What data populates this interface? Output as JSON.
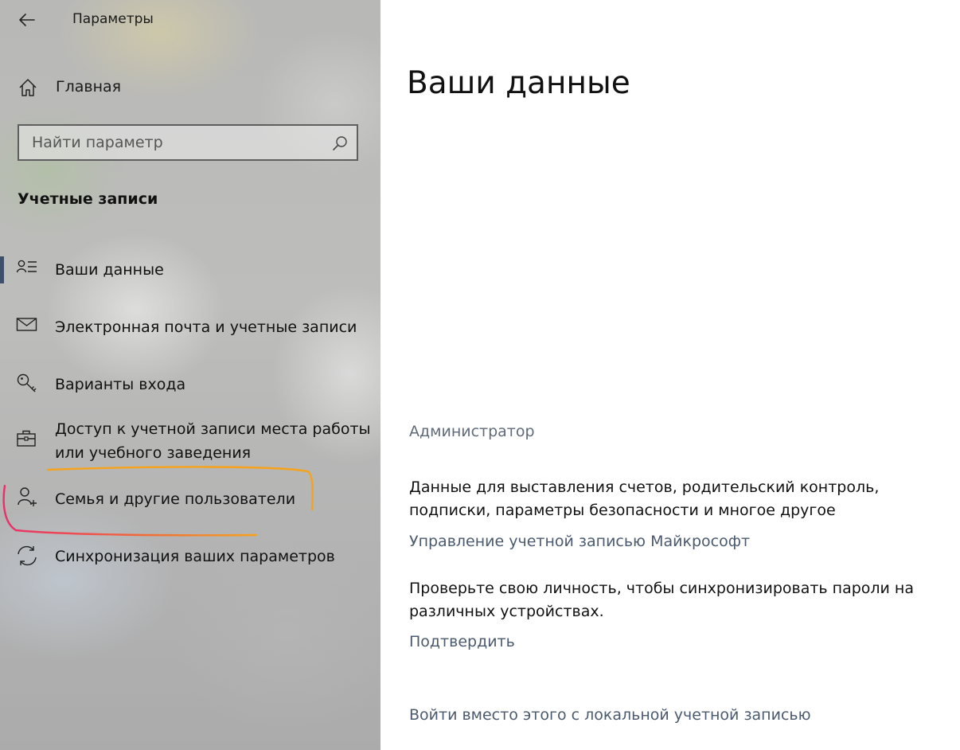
{
  "app": {
    "title": "Параметры"
  },
  "sidebar": {
    "home_label": "Главная",
    "search_placeholder": "Найти параметр",
    "section_heading": "Учетные записи",
    "items": [
      {
        "label": "Ваши данные",
        "icon": "person-list-icon",
        "selected": true
      },
      {
        "label": "Электронная почта и учетные записи",
        "icon": "mail-icon",
        "selected": false
      },
      {
        "label": "Варианты входа",
        "icon": "key-icon",
        "selected": false
      },
      {
        "label": "Доступ к учетной записи места работы или учебного заведения",
        "icon": "briefcase-icon",
        "selected": false
      },
      {
        "label": "Семья и другие пользователи",
        "icon": "person-add-icon",
        "selected": false
      },
      {
        "label": "Синхронизация ваших параметров",
        "icon": "sync-icon",
        "selected": false
      }
    ]
  },
  "main": {
    "title": "Ваши данные",
    "role": "Администратор",
    "billing_text": "Данные для выставления счетов, родительский контроль, подписки, параметры безопасности и многое другое",
    "manage_link": "Управление учетной записью Майкрософт",
    "verify_text": "Проверьте свою личность, чтобы синхронизировать пароли на различных устройствах.",
    "verify_link": "Подтвердить",
    "local_account_link": "Войти вместо этого с локальной учетной записью"
  },
  "colors": {
    "accent": "#3e4f6a",
    "link": "#4b5a6e",
    "muted": "#5f6b7a",
    "annotation_orange": "#f7a21b",
    "annotation_pink": "#e8306b"
  }
}
